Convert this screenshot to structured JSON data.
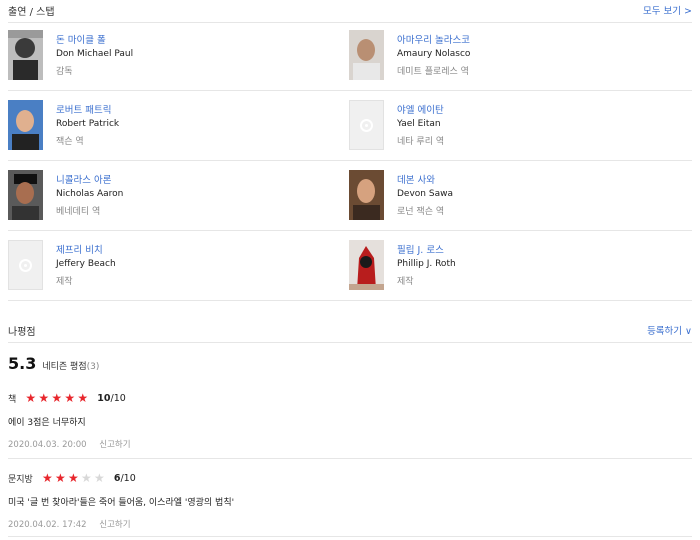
{
  "cast": {
    "title": "출연 / 스탭",
    "more": "모두 보기 >",
    "people": [
      {
        "name": "돈 마이클 폴",
        "en": "Don Michael Paul",
        "role": "감독",
        "photo": "dark"
      },
      {
        "name": "아마우리 놀라스코",
        "en": "Amaury Nolasco",
        "role": "데미트 플로레스 역",
        "photo": "bald"
      },
      {
        "name": "로버트 패트릭",
        "en": "Robert Patrick",
        "role": "잭슨 역",
        "photo": "blue"
      },
      {
        "name": "야엘 에이탄",
        "en": "Yael Eitan",
        "role": "네타 루리 역",
        "photo": "none"
      },
      {
        "name": "니콜라스 아론",
        "en": "Nicholas Aaron",
        "role": "베네데티 역",
        "photo": "cap"
      },
      {
        "name": "데본 사와",
        "en": "Devon Sawa",
        "role": "로넌 잭슨 역",
        "photo": "brown"
      },
      {
        "name": "제프리 비치",
        "en": "Jeffery Beach",
        "role": "제작",
        "photo": "none"
      },
      {
        "name": "필립 J. 로스",
        "en": "Phillip J. Roth",
        "role": "제작",
        "photo": "red"
      }
    ]
  },
  "reviews": {
    "title": "나평점",
    "register": "등록하기 ∨",
    "score": "5.3",
    "score_label": "네티즌 평점",
    "score_count": "(3)",
    "items": [
      {
        "user": "책",
        "stars": 5,
        "score": "10",
        "max": "/10",
        "text": "에이 3점은 너무하지",
        "date": "2020.04.03. 20:00",
        "report": "신고하기"
      },
      {
        "user": "문지방",
        "stars": 3,
        "score": "6",
        "max": "/10",
        "text": "미국 '글 번 찾아라'들은 죽어 들어움, 이스라엘 '영광의 법칙'",
        "date": "2020.04.02. 17:42",
        "report": "신고하기"
      }
    ]
  }
}
